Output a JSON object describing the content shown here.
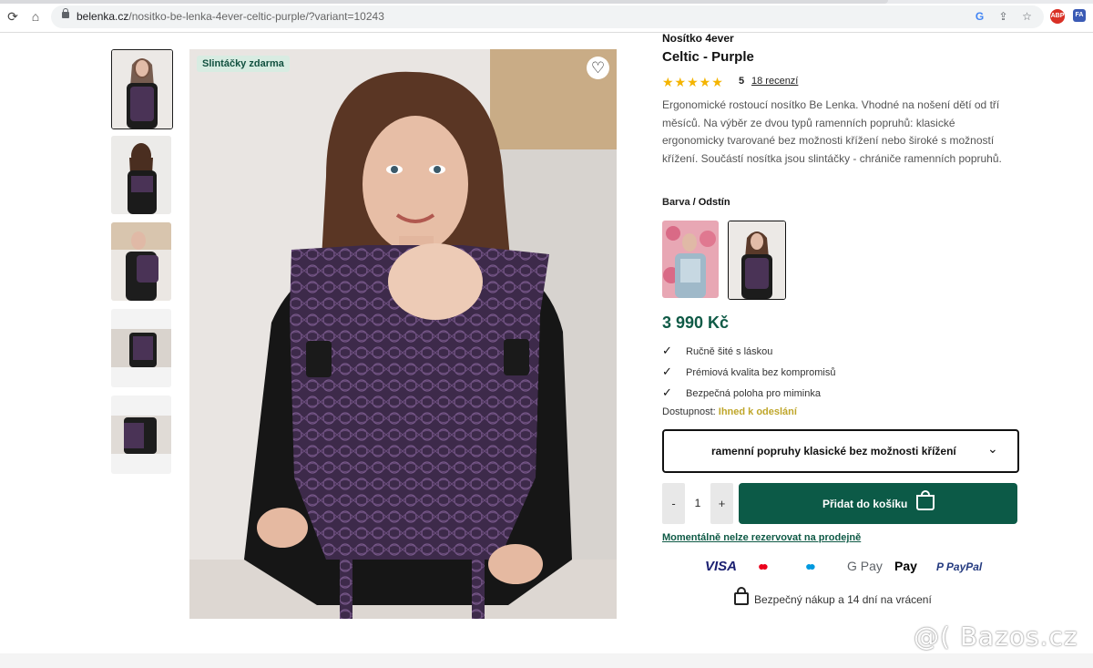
{
  "browser": {
    "url_domain": "belenka.cz",
    "url_path": "/nositko-be-lenka-4ever-celtic-purple/?variant=10243",
    "extensions": [
      "ABP",
      "FA"
    ]
  },
  "gallery": {
    "badge": "Slintáčky zdarma",
    "thumbnail_count": 5
  },
  "product": {
    "brand": "Nosítko 4ever",
    "title": "Celtic - Purple",
    "stars": "★★★★★",
    "rating": "5",
    "reviews": "18 recenzí",
    "description": "Ergonomické rostoucí nosítko Be Lenka. Vhodné na nošení dětí od tří měsíců. Na výběr ze dvou typů ramenních popruhů: klasické ergonomicky tvarované bez možnosti křížení nebo široké s možností křížení. Součástí nosítka jsou slintáčky - chrániče ramenních popruhů.",
    "color_label": "Barva",
    "color_sep": " / Odstín",
    "price": "3 990 Kč",
    "features": [
      "Ručně šité s láskou",
      "Prémiová kvalita bez kompromisů",
      "Bezpečná poloha pro miminka"
    ],
    "availability_label": "Dostupnost:",
    "availability_value": "Ihned k odeslání",
    "variant_select": "ramenní popruhy  klasické bez možnosti křížení",
    "qty_minus": "-",
    "qty_value": "1",
    "qty_plus": "+",
    "add_to_cart": "Přidat do košíku",
    "reserve_note": "Momentálně nelze rezervovat na prodejně",
    "payments": [
      "VISA",
      "●●",
      "●●",
      "G Pay",
      " Pay",
      "P PayPal"
    ],
    "secure_note": "Bezpečný nákup a 14 dní na vrácení"
  },
  "watermark": "@( Bazos.cz",
  "colors": {
    "accent": "#0c5a47",
    "badge_bg": "#d8ece2",
    "availability": "#bfa62a",
    "carrier": "#3f2a4c"
  }
}
